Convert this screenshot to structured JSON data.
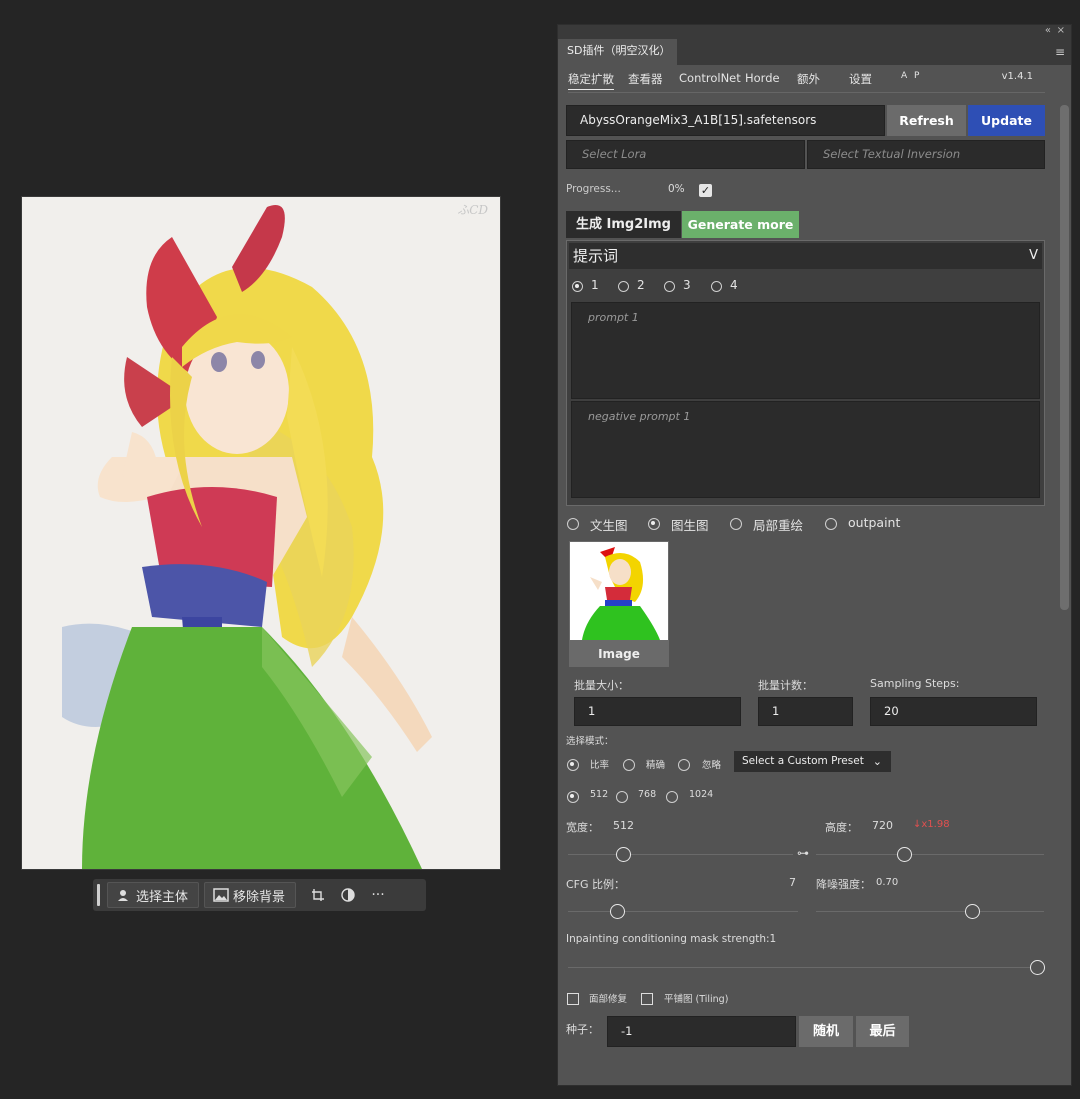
{
  "canvas": {
    "signature": "ふCD"
  },
  "context_toolbar": {
    "select_subject": "选择主体",
    "remove_background": "移除背景",
    "more": "···"
  },
  "panel": {
    "header": {
      "collapse": "«",
      "close": "×",
      "menu": "≡"
    },
    "tab_title": "SD插件（明空汉化）",
    "nav_tabs": [
      "稳定扩散",
      "查看器",
      "ControlNet",
      "Horde",
      "额外",
      "设置"
    ],
    "ap_badge": "A P",
    "version": "v1.4.1",
    "model": "AbyssOrangeMix3_A1B[15].safetensors",
    "refresh_label": "Refresh",
    "update_label": "Update",
    "lora_placeholder": "Select Lora",
    "ti_placeholder": "Select Textual Inversion",
    "progress_label": "Progress...",
    "progress_value": "0%",
    "gen_tab": "生成 Img2Img",
    "gen_more": "Generate more",
    "prompt_section": "提示词",
    "prompt_collapse": "V",
    "prompt_slots": [
      "1",
      "2",
      "3",
      "4"
    ],
    "prompt_placeholder": "prompt 1",
    "negative_placeholder": "negative prompt 1",
    "modes": [
      "文生图",
      "图生图",
      "局部重绘",
      "outpaint"
    ],
    "image_label": "Image",
    "batch_size_label": "批量大小：",
    "batch_size": "1",
    "batch_count_label": "批量计数：",
    "batch_count": "1",
    "steps_label": "Sampling Steps:",
    "steps": "20",
    "select_mode_label": "选择模式：",
    "mode_options": [
      "比率",
      "精确",
      "忽略"
    ],
    "preset_label": "Select a Custom Preset",
    "size_options": [
      "512",
      "768",
      "1024"
    ],
    "width_label": "宽度：",
    "width": "512",
    "height_label": "高度：",
    "height": "720",
    "ratio": "↓x1.98",
    "cfg_label": "CFG 比例：",
    "cfg": "7",
    "denoise_label": "降噪强度：",
    "denoise": "0.70",
    "mask_strength_label": "Inpainting conditioning mask strength:1",
    "face_restore_label": "面部修复",
    "tiling_label": "平铺图 (Tiling)",
    "seed_label": "种子：",
    "seed": "-1",
    "random_label": "随机",
    "last_label": "最后"
  },
  "colors": {
    "accent_blue": "#2e4fb5",
    "accent_green": "#6bb06b",
    "ratio_red": "#e05050"
  }
}
